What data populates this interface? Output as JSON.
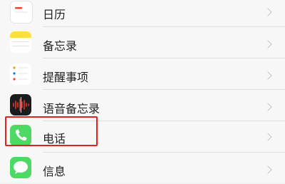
{
  "settings_list": {
    "items": [
      {
        "label": "日历",
        "icon": "calendar-icon"
      },
      {
        "label": "备忘录",
        "icon": "notes-icon"
      },
      {
        "label": "提醒事项",
        "icon": "reminders-icon"
      },
      {
        "label": "语音备忘录",
        "icon": "voice-memos-icon"
      },
      {
        "label": "电话",
        "icon": "phone-icon"
      },
      {
        "label": "信息",
        "icon": "messages-icon"
      }
    ]
  },
  "highlight": {
    "target": "电话",
    "color": "#e0221c"
  },
  "colors": {
    "phone_green": "#4cd964",
    "calendar_red": "#ff3b30",
    "notes_yellow": "#ffe03a",
    "voice_memo_dark": "#1c1c1e"
  }
}
